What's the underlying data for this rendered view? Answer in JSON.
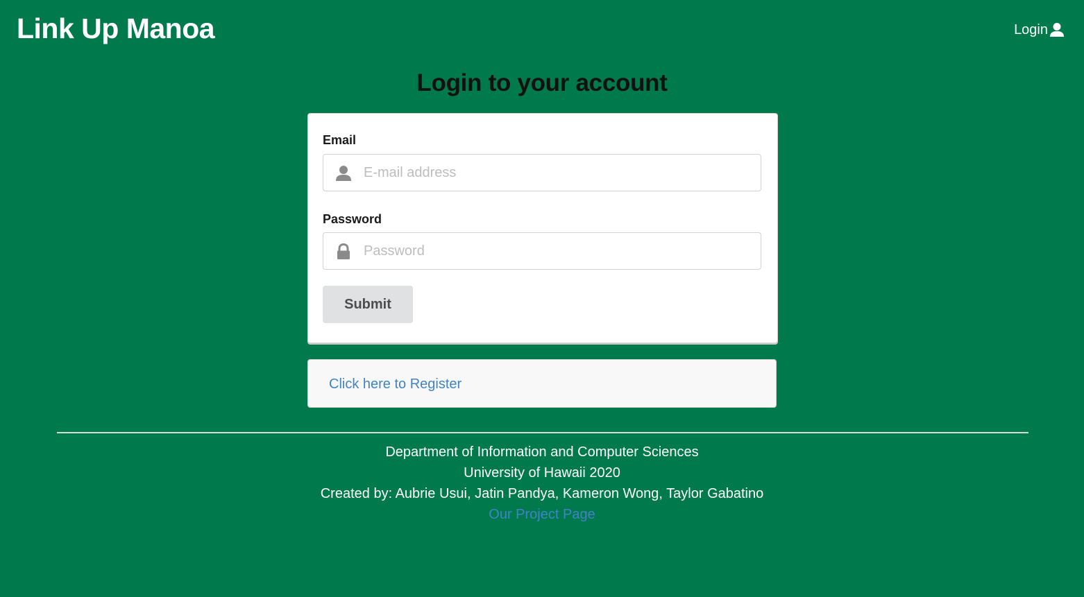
{
  "navbar": {
    "brand": "Link Up Manoa",
    "login_label": "Login"
  },
  "page": {
    "title": "Login to your account"
  },
  "form": {
    "email_label": "Email",
    "email_placeholder": "E-mail address",
    "email_value": "",
    "password_label": "Password",
    "password_placeholder": "Password",
    "password_value": "",
    "submit_label": "Submit"
  },
  "register": {
    "link_text": "Click here to Register"
  },
  "footer": {
    "line1": "Department of Information and Computer Sciences",
    "line2": "University of Hawaii 2020",
    "line3": "Created by: Aubrie Usui, Jatin Pandya, Kameron Wong, Taylor Gabatino",
    "project_link": "Our Project Page"
  },
  "icons": {
    "login": "user-icon",
    "email": "user-icon",
    "password": "lock-icon"
  },
  "colors": {
    "background": "#007a4d",
    "link": "#4183c4",
    "button": "#e0e1e2"
  }
}
